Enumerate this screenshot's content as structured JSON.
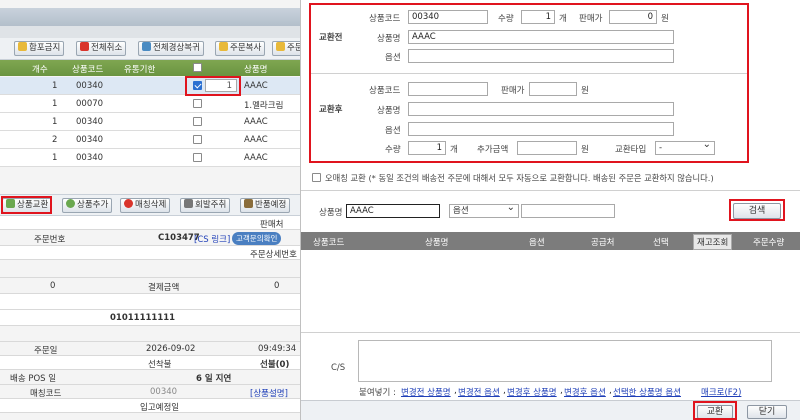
{
  "left": {
    "toolbar": [
      "합포금지",
      "전체취소",
      "전체경상복귀",
      "주문복사",
      "주문"
    ],
    "grid_headers": [
      "개수",
      "상품코드",
      "유통기한",
      "상품명"
    ],
    "rows": [
      {
        "qty": "1",
        "code": "00340",
        "checked": true,
        "count": "1",
        "name": "AAAC"
      },
      {
        "qty": "1",
        "code": "00070",
        "checked": false,
        "count": "",
        "name": "1.멜라크림"
      },
      {
        "qty": "1",
        "code": "00340",
        "checked": false,
        "count": "",
        "name": "AAAC"
      },
      {
        "qty": "2",
        "code": "00340",
        "checked": false,
        "count": "",
        "name": "AAAC"
      },
      {
        "qty": "1",
        "code": "00340",
        "checked": false,
        "count": "",
        "name": "AAAC"
      }
    ],
    "toolbar2": [
      "상품교환",
      "상품추가",
      "매칭삭제",
      "회발주취",
      "반품예정"
    ],
    "details": {
      "seller_label": "판매처",
      "order_no_label": "주문번호",
      "order_no": "C103477",
      "cs_link": "[CS 링크]",
      "confirm_badge": "고객문의확인",
      "order_detail_label": "주문상세번호",
      "zero1": "0",
      "pay_label": "결제금액",
      "zero2": "0",
      "phone": "01011111111",
      "order_date_label": "주문일",
      "order_date": "2026-09-02",
      "order_time": "09:49:34",
      "prepay_label": "선착불",
      "prepay_value": "선불(0)",
      "pos_label": "배송 POS 일",
      "delay": "6 일 지연",
      "match_label": "매칭코드",
      "match_code": "00340",
      "product_desc": "[상품설명]",
      "arrival_label": "입고예정일"
    }
  },
  "right": {
    "before_label": "교환전",
    "after_label": "교환후",
    "code_label": "상품코드",
    "before_code": "00340",
    "qty_label": "수량",
    "before_qty": "1",
    "unit_ea": "개",
    "price_label": "판매가",
    "before_price": "0",
    "unit_won": "원",
    "name_label": "상품명",
    "before_name": "AAAC",
    "option_label": "옵션",
    "after_qty": "1",
    "extra_label": "추가금액",
    "type_label": "교환타입",
    "type_value": "-",
    "unmatched_text": "오매칭 교환 (* 동일 조건의 배송전 주문에 대해서 모두 자동으로 교환합니다. 배송된 주문은 교환하지 않습니다.)",
    "search_name_label": "상품명",
    "search_name_value": "AAAC",
    "search_option_value": "옵션",
    "search_button": "검색",
    "result_headers": [
      "상품코드",
      "상품명",
      "옵션",
      "공급처",
      "선택",
      "재고조회",
      "주문수량"
    ],
    "cs_label": "C/S",
    "paste_label": "붙여넣기 :",
    "paste_links": [
      "변경전 상품명",
      "변경전 옵션",
      "변경후 상품명",
      "변경후 옵션",
      "선택한 상품명 옵션"
    ],
    "macro": "매크로(F2)",
    "exchange_button": "교환",
    "close_button": "닫기"
  }
}
